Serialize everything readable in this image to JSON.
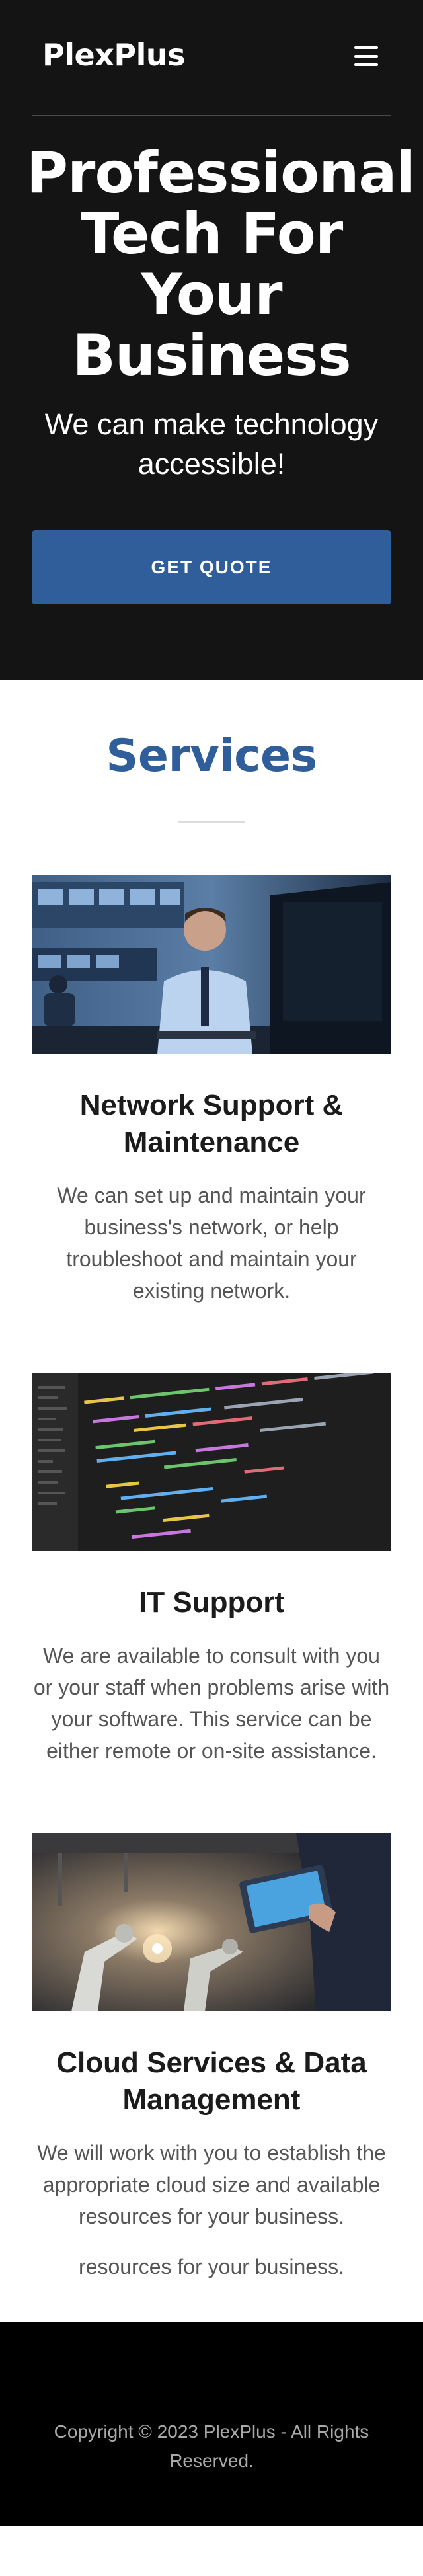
{
  "header": {
    "brand": "PlexPlus",
    "menu_icon": "hamburger-menu-icon"
  },
  "hero": {
    "title": "Professional Tech For Your Business",
    "subtitle": "We can make technology accessible!",
    "cta_label": "GET QUOTE"
  },
  "services": {
    "heading": "Services",
    "items": [
      {
        "title": "Network Support & Maintenance",
        "description": "We can set up and maintain your business's network, or help troubleshoot and maintain your existing network.",
        "image": "man-working-at-computer-photo"
      },
      {
        "title": "IT Support",
        "description": "We are available to consult with you or your staff when problems arise with your software. This service can be either remote or on-site assistance.",
        "image": "code-on-screen-photo"
      },
      {
        "title": "Cloud Services & Data Management",
        "description": "We will work with you to establish the appropriate cloud size and available resources for your business.",
        "extra": "resources for your business.",
        "image": "robotic-factory-tablet-photo"
      }
    ]
  },
  "footer": {
    "copyright": "Copyright © 2023 PlexPlus - All Rights Reserved."
  },
  "colors": {
    "accent": "#2f5e9b",
    "hero_bg": "#141414",
    "footer_bg": "#000000"
  }
}
